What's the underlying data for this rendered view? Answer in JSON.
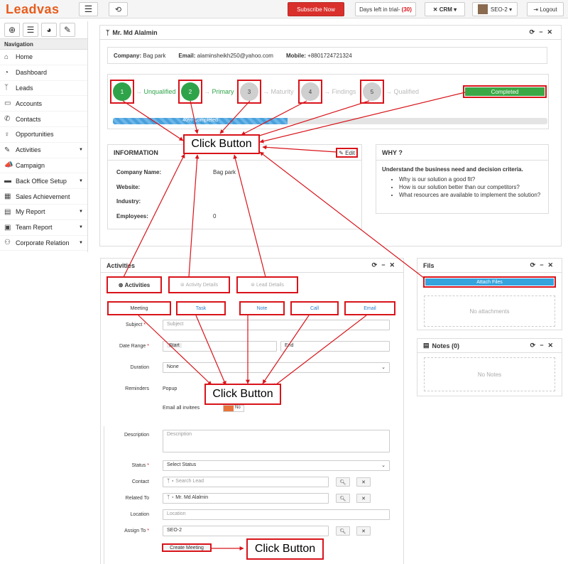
{
  "topbar": {
    "logo": "Leadvas",
    "subscribe": "Subscribe Now",
    "trial_label": "Days left in trial-",
    "trial_days": "(30)",
    "crm": "CRM",
    "user": "SEO-2",
    "logout": "Logout"
  },
  "sidebar": {
    "heading": "Navigation",
    "items": [
      {
        "label": "Home",
        "icon": "home-icon",
        "glyph": "⌂"
      },
      {
        "label": "Dashboard",
        "icon": "dashboard-icon",
        "glyph": "◔"
      },
      {
        "label": "Leads",
        "icon": "leads-icon",
        "glyph": "ᛉ"
      },
      {
        "label": "Accounts",
        "icon": "accounts-icon",
        "glyph": "▭"
      },
      {
        "label": "Contacts",
        "icon": "phone-icon",
        "glyph": "✆"
      },
      {
        "label": "Opportunities",
        "icon": "opportunities-icon",
        "glyph": "♀"
      },
      {
        "label": "Activities",
        "icon": "activities-icon",
        "glyph": "✎"
      },
      {
        "label": "Campaign",
        "icon": "campaign-icon",
        "glyph": "📣"
      },
      {
        "label": "Back Office Setup",
        "icon": "setup-icon",
        "glyph": "▬"
      },
      {
        "label": "Sales Achievement",
        "icon": "chart-icon",
        "glyph": "▦"
      },
      {
        "label": "My Report",
        "icon": "report-icon",
        "glyph": "▤"
      },
      {
        "label": "Team Report",
        "icon": "team-report-icon",
        "glyph": "▣"
      },
      {
        "label": "Corporate Relation",
        "icon": "relation-icon",
        "glyph": "⚇"
      }
    ]
  },
  "lead": {
    "title": "Mr. Md Alalmin",
    "company_label": "Company:",
    "company": "Bag park",
    "email_label": "Email:",
    "email": "alaminsheikh250@yahoo.com",
    "mobile_label": "Mobile:",
    "mobile": "+8801724721324"
  },
  "stages": [
    {
      "num": "1",
      "label": "Unqualified"
    },
    {
      "num": "2",
      "label": "Primary"
    },
    {
      "num": "3",
      "label": "Maturity"
    },
    {
      "num": "4",
      "label": "Findings"
    },
    {
      "num": "5",
      "label": "Qualified"
    }
  ],
  "completed_btn": "Completed",
  "progress": {
    "text": "40% Completed",
    "value": 0.4
  },
  "info": {
    "title": "INFORMATION",
    "edit": "Edit",
    "rows": [
      {
        "label": "Company Name:",
        "value": "Bag park"
      },
      {
        "label": "Website:",
        "value": ""
      },
      {
        "label": "Industry:",
        "value": ""
      },
      {
        "label": "Employees:",
        "value": "0"
      }
    ]
  },
  "why": {
    "title": "WHY ?",
    "heading": "Understand the business need and decision criteria.",
    "bullets": [
      "Why is our solution a good fit?",
      "How is our solution better than our competitors?",
      "What resources are available to implement the solution?"
    ]
  },
  "activities": {
    "title": "Activities",
    "tabs": [
      "Activities",
      "Activity Details",
      "Lead Details"
    ],
    "types": [
      "Meeting",
      "Task",
      "Note",
      "Call",
      "Email"
    ],
    "subject_label": "Subject",
    "subject_ph": "Subject",
    "date_label": "Date Range",
    "start": "Start",
    "end": "End",
    "duration_label": "Duration",
    "duration": "None",
    "reminders_label": "Reminders",
    "popup_label": "Popup",
    "no": "No",
    "email_invitees": "Email all invitees",
    "description_label": "Description",
    "description_ph": "Description",
    "status_label": "Status",
    "status": "Select Status",
    "contact_label": "Contact",
    "contact_ph": "Search Lead",
    "related_label": "Related To",
    "related": "Mr. Md Alalmin",
    "location_label": "Location",
    "location_ph": "Location",
    "assign_label": "Assign To",
    "assign": "SEO-2",
    "create_btn": "Create Meeting"
  },
  "files": {
    "title": "Fils",
    "attach": "Attach Files",
    "empty": "No attachments"
  },
  "notes": {
    "title": "Notes (0)",
    "empty": "No Notes"
  },
  "hints": [
    "Click Button",
    "Click Button",
    "Click Button"
  ]
}
